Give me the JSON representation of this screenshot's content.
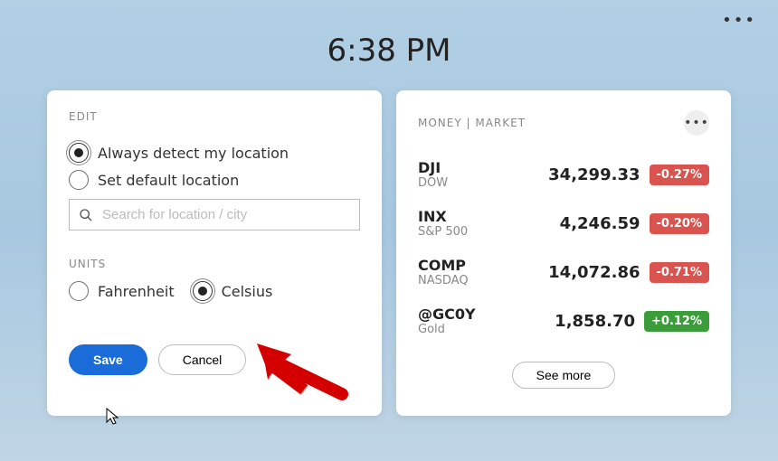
{
  "clock": "6:38 PM",
  "edit": {
    "title": "EDIT",
    "location": {
      "always_detect": "Always detect my location",
      "set_default": "Set default location",
      "selected": "always_detect",
      "search_placeholder": "Search for location / city"
    },
    "units": {
      "title": "UNITS",
      "fahrenheit": "Fahrenheit",
      "celsius": "Celsius",
      "selected": "celsius"
    },
    "buttons": {
      "save": "Save",
      "cancel": "Cancel"
    }
  },
  "money": {
    "title": "MONEY | MARKET",
    "rows": [
      {
        "sym": "DJI",
        "name": "DOW",
        "val": "34,299.33",
        "chg": "-0.27%",
        "dir": "down"
      },
      {
        "sym": "INX",
        "name": "S&P 500",
        "val": "4,246.59",
        "chg": "-0.20%",
        "dir": "down"
      },
      {
        "sym": "COMP",
        "name": "NASDAQ",
        "val": "14,072.86",
        "chg": "-0.71%",
        "dir": "down"
      },
      {
        "sym": "@GC0Y",
        "name": "Gold",
        "val": "1,858.70",
        "chg": "+0.12%",
        "dir": "up"
      }
    ],
    "see_more": "See more"
  }
}
